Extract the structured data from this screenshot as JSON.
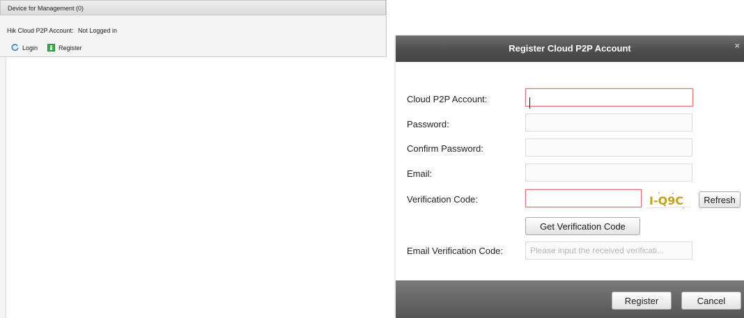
{
  "left_panel": {
    "header": "Device for Management (0)",
    "account_label": "Hik Cloud P2P Account:",
    "account_status": "Not Logged in",
    "toolbar": {
      "login_label": "Login",
      "register_label": "Register"
    }
  },
  "dialog": {
    "title": "Register Cloud P2P Account",
    "close_glyph": "×",
    "fields": {
      "account_label": "Cloud P2P Account:",
      "account_value": "",
      "password_label": "Password:",
      "confirm_label": "Confirm Password:",
      "email_label": "Email:",
      "code_label": "Verification Code:",
      "code_value": "",
      "captcha_text": "I-Q9C",
      "refresh_label": "Refresh",
      "get_code_label": "Get Verification Code",
      "email_code_label": "Email Verification Code:",
      "email_code_placeholder": "Please input the received verificati..."
    },
    "footer": {
      "register_label": "Register",
      "cancel_label": "Cancel"
    }
  },
  "colors": {
    "error_border": "#e07070",
    "titlebar": "#555555",
    "register_icon": "#3bb04a",
    "login_icon": "#3a8fd8"
  }
}
